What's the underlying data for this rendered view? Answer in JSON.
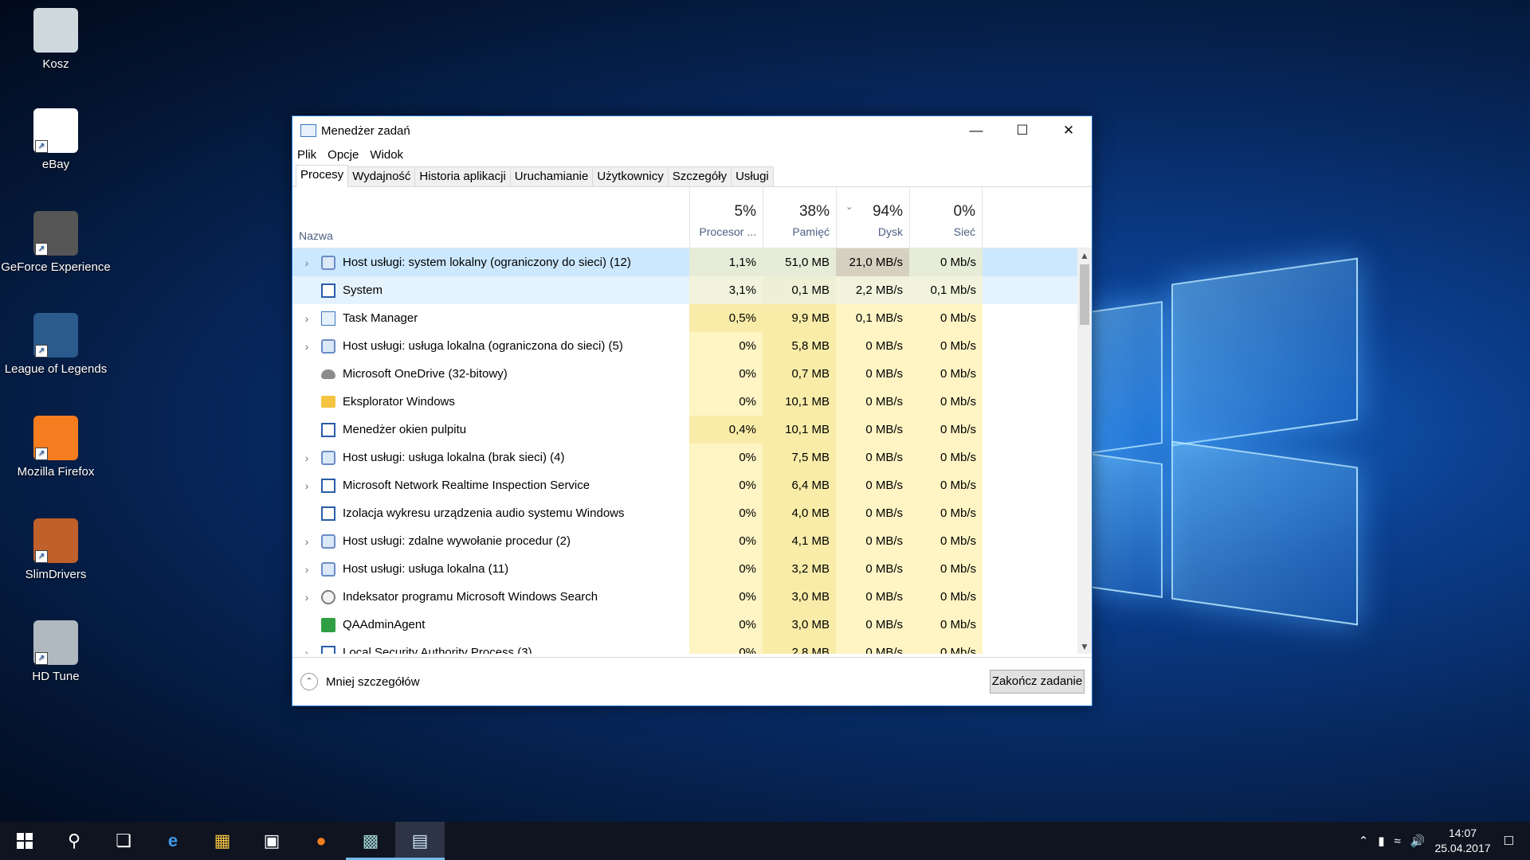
{
  "desktop": {
    "icons": [
      {
        "label": "Kosz",
        "icon": "recycle-bin-icon"
      },
      {
        "label": "eBay",
        "icon": "ebay-icon"
      },
      {
        "label": "GeForce Experience",
        "icon": "geforce-icon"
      },
      {
        "label": "League of Legends",
        "icon": "league-icon"
      },
      {
        "label": "Mozilla Firefox",
        "icon": "firefox-icon"
      },
      {
        "label": "SlimDrivers",
        "icon": "slimdrivers-icon"
      },
      {
        "label": "HD Tune",
        "icon": "hdtune-icon"
      }
    ]
  },
  "window": {
    "title": "Menedżer zadań",
    "menu": [
      "Plik",
      "Opcje",
      "Widok"
    ],
    "tabs": [
      "Procesy",
      "Wydajność",
      "Historia aplikacji",
      "Uruchamianie",
      "Użytkownicy",
      "Szczegóły",
      "Usługi"
    ],
    "active_tab": "Procesy"
  },
  "table": {
    "name_header": "Nazwa",
    "columns": [
      {
        "pct": "5%",
        "label": "Procesor ..."
      },
      {
        "pct": "38%",
        "label": "Pamięć"
      },
      {
        "pct": "94%",
        "label": "Dysk"
      },
      {
        "pct": "0%",
        "label": "Sieć"
      }
    ],
    "rows": [
      {
        "name": "Host usługi: system lokalny (ograniczony do sieci) (12)",
        "cpu": "1,1%",
        "mem": "51,0 MB",
        "disk": "21,0 MB/s",
        "net": "0 Mb/s",
        "expand": true,
        "icon": "gear"
      },
      {
        "name": "System",
        "cpu": "3,1%",
        "mem": "0,1 MB",
        "disk": "2,2 MB/s",
        "net": "0,1 Mb/s",
        "expand": false,
        "icon": "app"
      },
      {
        "name": "Task Manager",
        "cpu": "0,5%",
        "mem": "9,9 MB",
        "disk": "0,1 MB/s",
        "net": "0 Mb/s",
        "expand": true,
        "icon": "chart"
      },
      {
        "name": "Host usługi: usługa lokalna (ograniczona do sieci) (5)",
        "cpu": "0%",
        "mem": "5,8 MB",
        "disk": "0 MB/s",
        "net": "0 Mb/s",
        "expand": true,
        "icon": "gear"
      },
      {
        "name": "Microsoft OneDrive (32-bitowy)",
        "cpu": "0%",
        "mem": "0,7 MB",
        "disk": "0 MB/s",
        "net": "0 Mb/s",
        "expand": false,
        "icon": "cloud"
      },
      {
        "name": "Eksplorator Windows",
        "cpu": "0%",
        "mem": "10,1 MB",
        "disk": "0 MB/s",
        "net": "0 Mb/s",
        "expand": false,
        "icon": "folder"
      },
      {
        "name": "Menedżer okien pulpitu",
        "cpu": "0,4%",
        "mem": "10,1 MB",
        "disk": "0 MB/s",
        "net": "0 Mb/s",
        "expand": false,
        "icon": "app"
      },
      {
        "name": "Host usługi: usługa lokalna (brak sieci) (4)",
        "cpu": "0%",
        "mem": "7,5 MB",
        "disk": "0 MB/s",
        "net": "0 Mb/s",
        "expand": true,
        "icon": "gear"
      },
      {
        "name": "Microsoft Network Realtime Inspection Service",
        "cpu": "0%",
        "mem": "6,4 MB",
        "disk": "0 MB/s",
        "net": "0 Mb/s",
        "expand": true,
        "icon": "app"
      },
      {
        "name": "Izolacja wykresu urządzenia audio systemu Windows",
        "cpu": "0%",
        "mem": "4,0 MB",
        "disk": "0 MB/s",
        "net": "0 Mb/s",
        "expand": false,
        "icon": "app"
      },
      {
        "name": "Host usługi: zdalne wywołanie procedur (2)",
        "cpu": "0%",
        "mem": "4,1 MB",
        "disk": "0 MB/s",
        "net": "0 Mb/s",
        "expand": true,
        "icon": "gear"
      },
      {
        "name": "Host usługi: usługa lokalna (11)",
        "cpu": "0%",
        "mem": "3,2 MB",
        "disk": "0 MB/s",
        "net": "0 Mb/s",
        "expand": true,
        "icon": "gear"
      },
      {
        "name": "Indeksator programu Microsoft Windows Search",
        "cpu": "0%",
        "mem": "3,0 MB",
        "disk": "0 MB/s",
        "net": "0 Mb/s",
        "expand": true,
        "icon": "search"
      },
      {
        "name": "QAAdminAgent",
        "cpu": "0%",
        "mem": "3,0 MB",
        "disk": "0 MB/s",
        "net": "0 Mb/s",
        "expand": false,
        "icon": "green"
      },
      {
        "name": "Local Security Authority Process (3)",
        "cpu": "0%",
        "mem": "2,8 MB",
        "disk": "0 MB/s",
        "net": "0 Mb/s",
        "expand": true,
        "icon": "app"
      }
    ]
  },
  "footer": {
    "fewer_details": "Mniej szczegółów",
    "end_task": "Zakończ zadanie"
  },
  "taskbar": {
    "clock_time": "14:07",
    "clock_date": "25.04.2017"
  },
  "colors": {
    "heat_light": "#fff4c4",
    "heat_mid": "#f9eca8",
    "heat_disk_hot": "#d6d0c0",
    "selected_row": "#cce8ff",
    "hover_row": "#e5f3ff"
  }
}
